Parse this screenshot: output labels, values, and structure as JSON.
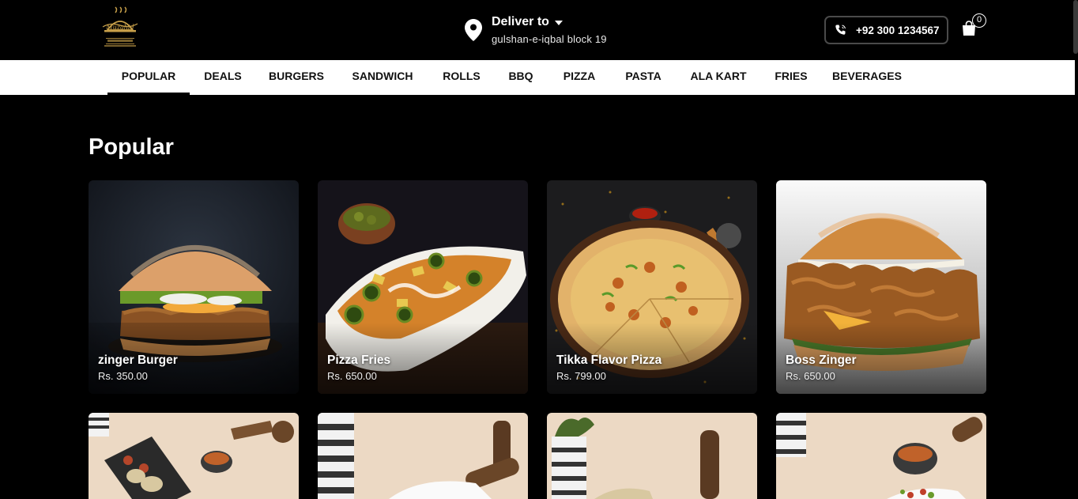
{
  "brand": {
    "logo_text": "Muzahid",
    "logo_sub": "FAST FOOD & BAR.B.Q"
  },
  "delivery": {
    "title": "Deliver to",
    "address": "gulshan-e-iqbal block 19"
  },
  "contact": {
    "phone": "+92 300 1234567"
  },
  "cart": {
    "count": "0"
  },
  "nav": {
    "items": [
      {
        "label": "POPULAR",
        "active": true
      },
      {
        "label": "DEALS"
      },
      {
        "label": "BURGERS"
      },
      {
        "label": "SANDWICH"
      },
      {
        "label": "ROLLS"
      },
      {
        "label": "BBQ"
      },
      {
        "label": "PIZZA"
      },
      {
        "label": "PASTA"
      },
      {
        "label": "ALA KART"
      },
      {
        "label": "FRIES"
      },
      {
        "label": "BEVERAGES"
      }
    ]
  },
  "section": {
    "title": "Popular"
  },
  "products": [
    {
      "name": "zinger Burger",
      "price": "Rs. 350.00"
    },
    {
      "name": "Pizza Fries",
      "price": "Rs. 650.00"
    },
    {
      "name": "Tikka Flavor Pizza",
      "price": "Rs. 799.00"
    },
    {
      "name": "Boss Zinger",
      "price": "Rs. 650.00"
    }
  ],
  "colors": {
    "background": "#000000",
    "nav_bg": "#ffffff",
    "accent": "#c8a04a"
  }
}
